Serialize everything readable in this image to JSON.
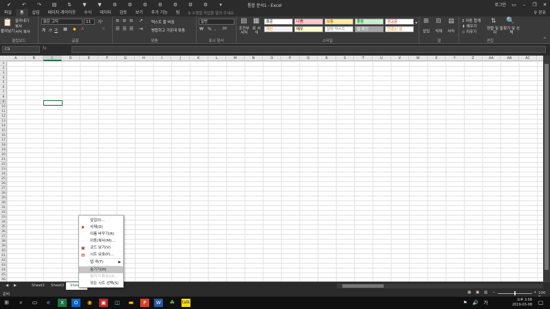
{
  "titlebar": {
    "title": "통합 문서1 - Excel",
    "qat_icons": [
      "save-icon",
      "undo-icon",
      "redo-icon",
      "print-icon",
      "sort-icon",
      "filter-icon",
      "filter-icon",
      "chart-icon",
      "chart-icon",
      "chart-icon",
      "chart-icon",
      "chart-icon",
      "chart-icon",
      "chart-icon",
      "more-icon"
    ],
    "login": "로그인",
    "buttons": [
      "ribbon-display-icon",
      "minimize-icon",
      "restore-icon",
      "close-icon"
    ]
  },
  "tabs": {
    "items": [
      "파일",
      "홈",
      "삽입",
      "페이지 레이아웃",
      "수식",
      "데이터",
      "검토",
      "보기",
      "추가 기능",
      "팀"
    ],
    "active": "홈",
    "tell_me": "♀ 수행할 작업을 알려 주세요",
    "share": "♀ 공유"
  },
  "ribbon": {
    "clipboard": {
      "paste": "붙여넣기",
      "cut": "잘라내기",
      "copy": "복사",
      "format_painter": "서식 복사",
      "label": "클립보드"
    },
    "font": {
      "name": "맑은 고딕",
      "size": "11",
      "bold": "가",
      "italic": "가",
      "underline": "가",
      "label": "글꼴"
    },
    "align": {
      "wrap": "텍스트 줄 바꿈",
      "merge": "병합하고 가운데 맞춤",
      "label": "맞춤"
    },
    "number": {
      "format": "일반",
      "label": "표시 형식"
    },
    "styles": {
      "cond": "조건부 서식",
      "table": "표 서식",
      "cells": [
        {
          "label": "표준",
          "bg": "#ffffff",
          "fg": "#000000"
        },
        {
          "label": "나쁨",
          "bg": "#ffc7ce",
          "fg": "#9c0006"
        },
        {
          "label": "보통",
          "bg": "#ffeb9c",
          "fg": "#9c5700"
        },
        {
          "label": "좋음",
          "bg": "#c6efce",
          "fg": "#006100"
        },
        {
          "label": "경고문",
          "bg": "#ffffff",
          "fg": "#ff0000"
        },
        {
          "label": "계산",
          "bg": "#f2f2f2",
          "fg": "#fa7d00"
        },
        {
          "label": "메모",
          "bg": "#ffffcc",
          "fg": "#000000"
        },
        {
          "label": "설명 텍스트",
          "bg": "#ffffff",
          "fg": "#7f7f7f"
        },
        {
          "label": "셀 확인",
          "bg": "#a5a5a5",
          "fg": "#ffffff"
        },
        {
          "label": "연결된 셀",
          "bg": "#ffffff",
          "fg": "#fa7d00"
        }
      ],
      "label": "스타일"
    },
    "cells": {
      "insert": "삽입",
      "delete": "삭제",
      "format": "서식",
      "label": "셀"
    },
    "editing": {
      "autosum": "자동 합계",
      "fill": "채우기",
      "clear": "지우기",
      "sort": "정렬 및 필터",
      "find": "찾기 및 선택",
      "label": "편집"
    }
  },
  "formula_bar": {
    "name_box": "C9",
    "fx": "fx",
    "value": ""
  },
  "columns": [
    "A",
    "B",
    "C",
    "D",
    "E",
    "F",
    "G",
    "H",
    "I",
    "J",
    "K",
    "L",
    "M",
    "N",
    "O",
    "P",
    "Q",
    "R",
    "S",
    "T",
    "U",
    "V",
    "W",
    "X",
    "Y",
    "Z",
    "AA",
    "AB",
    "AC"
  ],
  "rows": [
    "1",
    "2",
    "3",
    "4",
    "5",
    "6",
    "7",
    "8",
    "9",
    "10",
    "11",
    "12",
    "13",
    "14",
    "15",
    "16",
    "17",
    "18",
    "19",
    "20",
    "21",
    "22",
    "23",
    "24",
    "25",
    "26",
    "27",
    "28",
    "29",
    "30",
    "31",
    "32",
    "33",
    "34",
    "35",
    "36",
    "37",
    "38",
    "39",
    "40",
    "41",
    "42",
    "43",
    "44",
    "45",
    "46"
  ],
  "active_row": "9",
  "active_col": "C",
  "sheets": [
    "Sheet1",
    "Sheet2",
    "Sheet3"
  ],
  "active_sheet": "Sheet3",
  "status": {
    "ready": "준비",
    "zoom": "100 %"
  },
  "context_menu": {
    "items": [
      {
        "label": "삽입(I)...",
        "disabled": false,
        "icon": ""
      },
      {
        "label": "삭제(D)",
        "disabled": false,
        "icon": "delete-sheet-icon"
      },
      {
        "label": "이름 바꾸기(R)",
        "disabled": false,
        "icon": ""
      },
      {
        "label": "이동/복사(M)...",
        "disabled": false,
        "icon": ""
      },
      {
        "label": "코드 보기(V)",
        "disabled": false,
        "icon": "code-icon"
      },
      {
        "label": "시트 보호(P)...",
        "disabled": false,
        "icon": "protect-icon"
      },
      {
        "label": "탭 색(T)",
        "disabled": false,
        "icon": "",
        "submenu": true
      },
      {
        "label": "숨기기(H)",
        "disabled": false,
        "icon": "",
        "highlight": true
      },
      {
        "label": "숨기기 취소(U)...",
        "disabled": true,
        "icon": ""
      },
      {
        "label": "모든 시트 선택(S)",
        "disabled": false,
        "icon": ""
      }
    ]
  },
  "taskbar": {
    "time": "오후 3:58",
    "date": "2019-03-08",
    "apps": [
      "windows-icon",
      "search-icon",
      "task-view-icon",
      "ie-icon",
      "excel-icon",
      "outlook-icon",
      "chrome-icon",
      "app-icon",
      "files-icon",
      "powerpoint-icon",
      "word-icon",
      "game-icon",
      "chat-icon"
    ]
  }
}
